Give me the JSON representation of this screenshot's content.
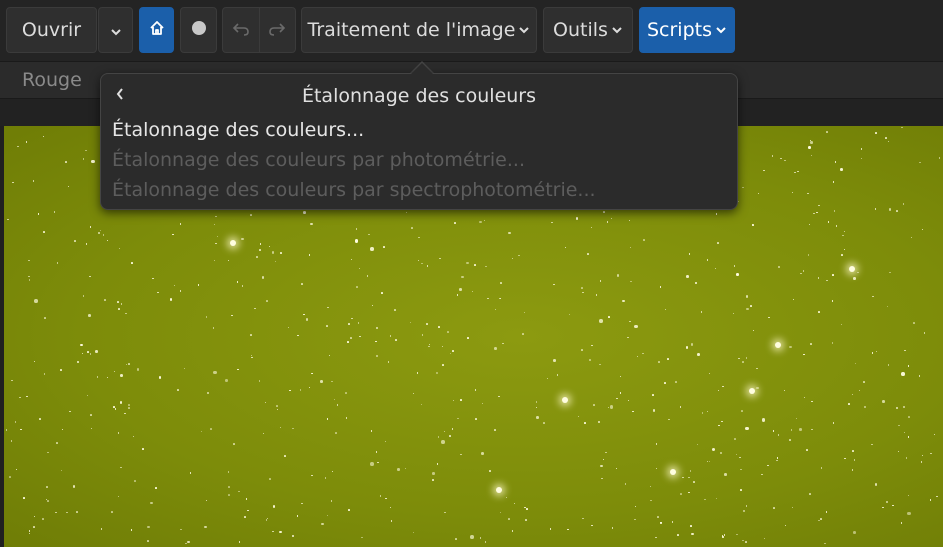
{
  "toolbar": {
    "open_label": "Ouvrir",
    "image_processing_label": "Traitement de l'image",
    "tools_label": "Outils",
    "scripts_label": "Scripts"
  },
  "tabs": {
    "active_label": "Rouge"
  },
  "popover": {
    "title": "Étalonnage des couleurs",
    "items": [
      {
        "label": "Étalonnage des couleurs...",
        "enabled": true
      },
      {
        "label": "Étalonnage des couleurs par photométrie...",
        "enabled": false
      },
      {
        "label": "Étalonnage des couleurs par spectrophotométrie...",
        "enabled": false
      }
    ]
  },
  "colors": {
    "accent": "#1b5faa",
    "background": "#242424",
    "image_tint": "#8c9a10"
  },
  "icons": [
    "chevron-down-icon",
    "home-icon",
    "record-dot-icon",
    "undo-icon",
    "redo-icon",
    "chevron-left-icon"
  ]
}
